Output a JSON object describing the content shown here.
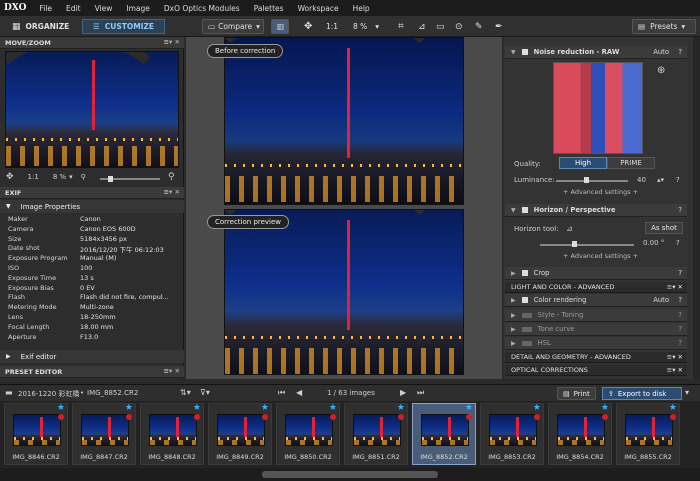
{
  "app": {
    "logo": "DXO"
  },
  "menu": [
    "File",
    "Edit",
    "View",
    "Image",
    "DxO Optics Modules",
    "Palettes",
    "Workspace",
    "Help"
  ],
  "toolbar": {
    "organize": "ORGANIZE",
    "customize": "CUSTOMIZE",
    "compare": "Compare",
    "ratio": "1:1",
    "zoom": "8 %",
    "presets": "Presets"
  },
  "movezoom": {
    "title": "MOVE/ZOOM",
    "ratio": "1:1",
    "zoom": "8 %"
  },
  "exif": {
    "title": "EXIF",
    "section": "Image Properties",
    "rows": [
      [
        "Maker",
        "Canon"
      ],
      [
        "Camera",
        "Canon EOS 600D"
      ],
      [
        "Size",
        "5184x3456 px"
      ],
      [
        "Date shot",
        "2016/12/20 下午 06:12:03"
      ],
      [
        "Exposure Program",
        "Manual (M)"
      ],
      [
        "ISO",
        "100"
      ],
      [
        "Exposure Time",
        "13 s"
      ],
      [
        "Exposure Bias",
        "0 EV"
      ],
      [
        "Flash",
        "Flash did not fire, compul..."
      ],
      [
        "Metering Mode",
        "Multi-zone"
      ],
      [
        "Lens",
        "18-250mm"
      ],
      [
        "Focal Length",
        "18.00 mm"
      ],
      [
        "Aperture",
        "F13.0"
      ]
    ],
    "exif_editor": "Exif editor"
  },
  "preset_editor": {
    "title": "PRESET EDITOR"
  },
  "viewer": {
    "before": "Before correction",
    "after": "Correction preview"
  },
  "right": {
    "noise": {
      "title": "Noise reduction - RAW",
      "auto": "Auto",
      "quality_label": "Quality:",
      "high": "High",
      "prime": "PRIME",
      "luminance_label": "Luminance:",
      "luminance_value": "40",
      "advanced": "+ Advanced settings +"
    },
    "horizon": {
      "title": "Horizon / Perspective",
      "tool_label": "Horizon tool:",
      "as_shot": "As shot",
      "angle": "0.00 °",
      "advanced": "+ Advanced settings +"
    },
    "crop": "Crop",
    "light_color": "LIGHT AND COLOR - ADVANCED",
    "color_rendering": "Color rendering",
    "color_auto": "Auto",
    "style": "Style - Toning",
    "tone": "Tone curve",
    "hsl": "HSL",
    "detail": "DETAIL AND GEOMETRY - ADVANCED",
    "optical": "OPTICAL CORRECTIONS"
  },
  "filmstrip": {
    "folder": "2016-1220 彩虹橋",
    "file": "IMG_8852.CR2",
    "counter": "1 / 63 images",
    "print": "Print",
    "export": "Export to disk",
    "thumbs": [
      "IMG_8846.CR2",
      "IMG_8847.CR2",
      "IMG_8848.CR2",
      "IMG_8849.CR2",
      "IMG_8850.CR2",
      "IMG_8851.CR2",
      "IMG_8852.CR2",
      "IMG_8853.CR2",
      "IMG_8854.CR2",
      "IMG_8855.CR2"
    ],
    "selected_index": 6
  },
  "colors": {
    "accent": "#3cb0ff",
    "tower": "#e3223a"
  }
}
